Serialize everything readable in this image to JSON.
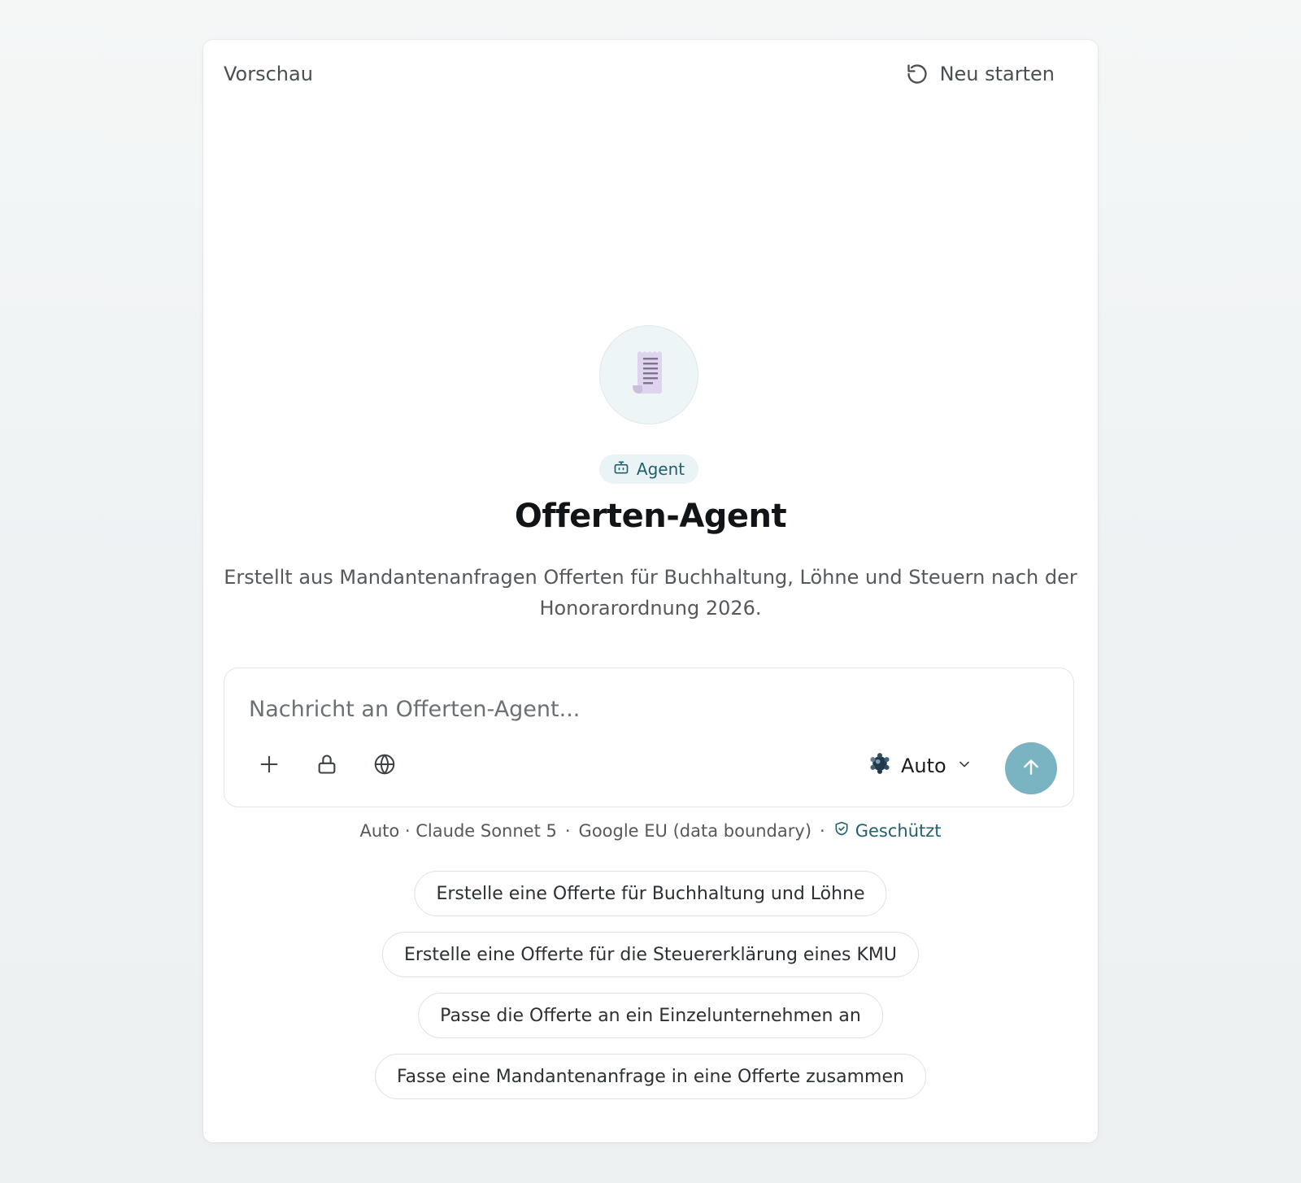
{
  "header": {
    "title": "Vorschau",
    "restart_label": "Neu starten",
    "restart_icon": "restart-icon"
  },
  "agent": {
    "avatar_icon": "receipt-icon",
    "badge_icon": "robot-icon",
    "badge_label": "Agent",
    "name": "Offerten-Agent",
    "description": "Erstellt aus Mandantenanfragen Offerten für Buchhaltung, Löhne und Steuern nach der Honorarordnung 2026."
  },
  "composer": {
    "placeholder": "Nachricht an Offerten-Agent...",
    "value": "",
    "tools": [
      "plus-icon",
      "lock-icon",
      "globe-icon"
    ],
    "model_icon": "model-logo-icon",
    "model_label": "Auto",
    "send_icon": "arrow-up-icon"
  },
  "model_info": {
    "mode": "Auto · Claude Sonnet 5",
    "region": "Google EU (data boundary)",
    "separator": "·",
    "protected_label": "Geschützt",
    "protected_icon": "shield-check-icon"
  },
  "suggestions": [
    "Erstelle eine Offerte für Buchhaltung und Löhne",
    "Erstelle eine Offerte für die Steuererklärung eines KMU",
    "Passe die Offerte an ein Einzelunternehmen an",
    "Fasse eine Mandantenanfrage in eine Offerte zusammen"
  ],
  "colors": {
    "accent": "#21606c",
    "send_button": "#7ab3c2",
    "badge_bg": "#eaf3f5",
    "avatar_bg": "#eef5f6"
  }
}
